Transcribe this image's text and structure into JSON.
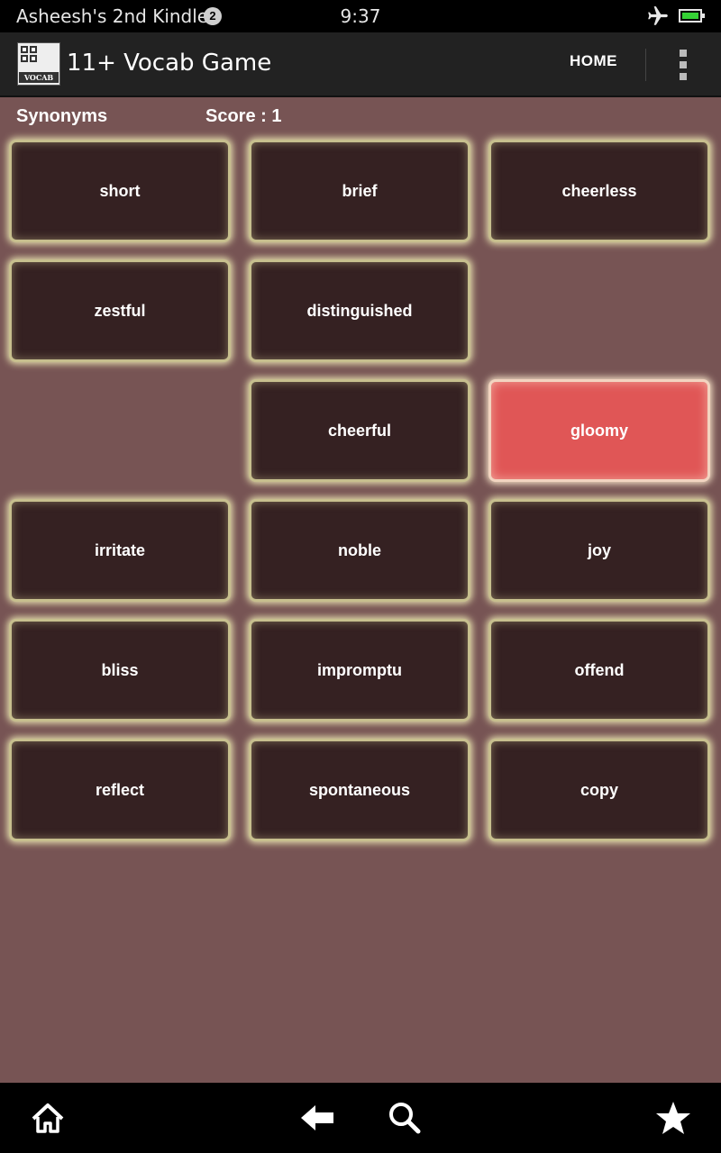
{
  "status_bar": {
    "device_name": "Asheesh's 2nd Kindle",
    "notification_count": "2",
    "time": "9:37",
    "airplane_icon": "airplane-icon",
    "battery_icon": "battery-icon",
    "battery_color": "#35d235"
  },
  "action_bar": {
    "logo_caption": "VOCAB",
    "title": "11+ Vocab Game",
    "home_label": "HOME",
    "overflow_icon": "overflow-menu-icon"
  },
  "game": {
    "mode": "Synonyms",
    "score": "Score : 1"
  },
  "tiles": [
    {
      "label": "short"
    },
    {
      "label": "brief"
    },
    {
      "label": "cheerless"
    },
    {
      "label": "zestful"
    },
    {
      "label": "distinguished"
    },
    {
      "label": ""
    },
    {
      "label": ""
    },
    {
      "label": "cheerful"
    },
    {
      "label": "gloomy",
      "selected": true
    },
    {
      "label": "irritate"
    },
    {
      "label": "noble"
    },
    {
      "label": "joy"
    },
    {
      "label": "bliss"
    },
    {
      "label": "impromptu"
    },
    {
      "label": "offend"
    },
    {
      "label": "reflect"
    },
    {
      "label": "spontaneous"
    },
    {
      "label": "copy"
    }
  ],
  "colors": {
    "background": "#775454",
    "tile": "#352122",
    "tile_selected": "#e05656",
    "tile_glow": "#c7bf8e"
  },
  "nav_bar": {
    "icons": [
      "home-icon",
      "back-arrow-icon",
      "search-icon",
      "favorites-star-icon"
    ]
  }
}
